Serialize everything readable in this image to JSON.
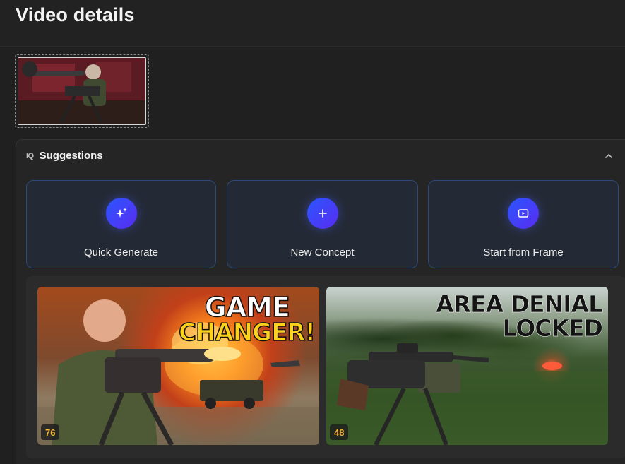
{
  "header": {
    "title": "Video details"
  },
  "suggestions": {
    "icon_label": "IQ",
    "title": "Suggestions",
    "collapse_icon": "chevron-up-icon",
    "actions": [
      {
        "label": "Quick Generate",
        "icon": "sparkles-icon"
      },
      {
        "label": "New Concept",
        "icon": "plus-icon"
      },
      {
        "label": "Start from Frame",
        "icon": "video-frame-icon"
      }
    ],
    "concepts": [
      {
        "headline_line1": "GAME",
        "headline_line2": "CHANGER!",
        "score": "76"
      },
      {
        "headline_line1": "AREA DENIAL",
        "headline_line2": "LOCKED",
        "score": "48"
      }
    ]
  },
  "colors": {
    "background": "#202020",
    "accent": "#2e4a78",
    "icon_gradient_start": "#2a56ff",
    "icon_gradient_end": "#5a2cf0",
    "score_text": "#f3b53a",
    "changer_yellow": "#ffd21a"
  }
}
